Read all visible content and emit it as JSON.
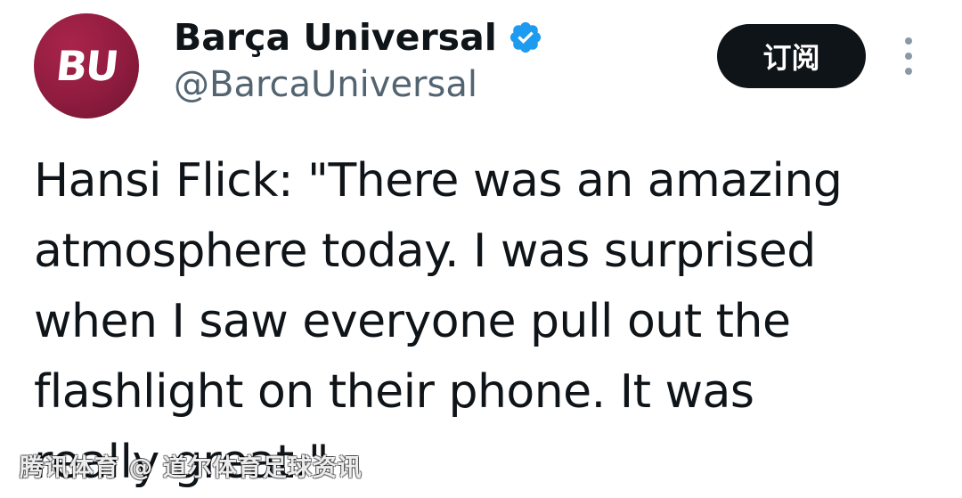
{
  "account": {
    "avatar_text": "BU",
    "display_name": "Barça Universal",
    "handle": "@BarcaUniversal",
    "verified_icon": "verified-badge-icon"
  },
  "actions": {
    "subscribe_label": "订阅",
    "more_icon": "more-vertical-icon"
  },
  "tweet": {
    "lines": [
      "Hansi Flick: \"There was an amazing",
      "atmosphere today. I was surprised",
      "when I saw everyone pull out the",
      "flashlight on their phone. It was",
      "really great.\""
    ]
  },
  "watermark": {
    "text": "腾讯体育 @ 道尔体育足球资讯"
  },
  "colors": {
    "avatar_bg": "#8f1c3f",
    "verified_blue": "#1d9bf0",
    "button_bg": "#0f1419",
    "handle_gray": "#536471",
    "text": "#0f1419"
  }
}
